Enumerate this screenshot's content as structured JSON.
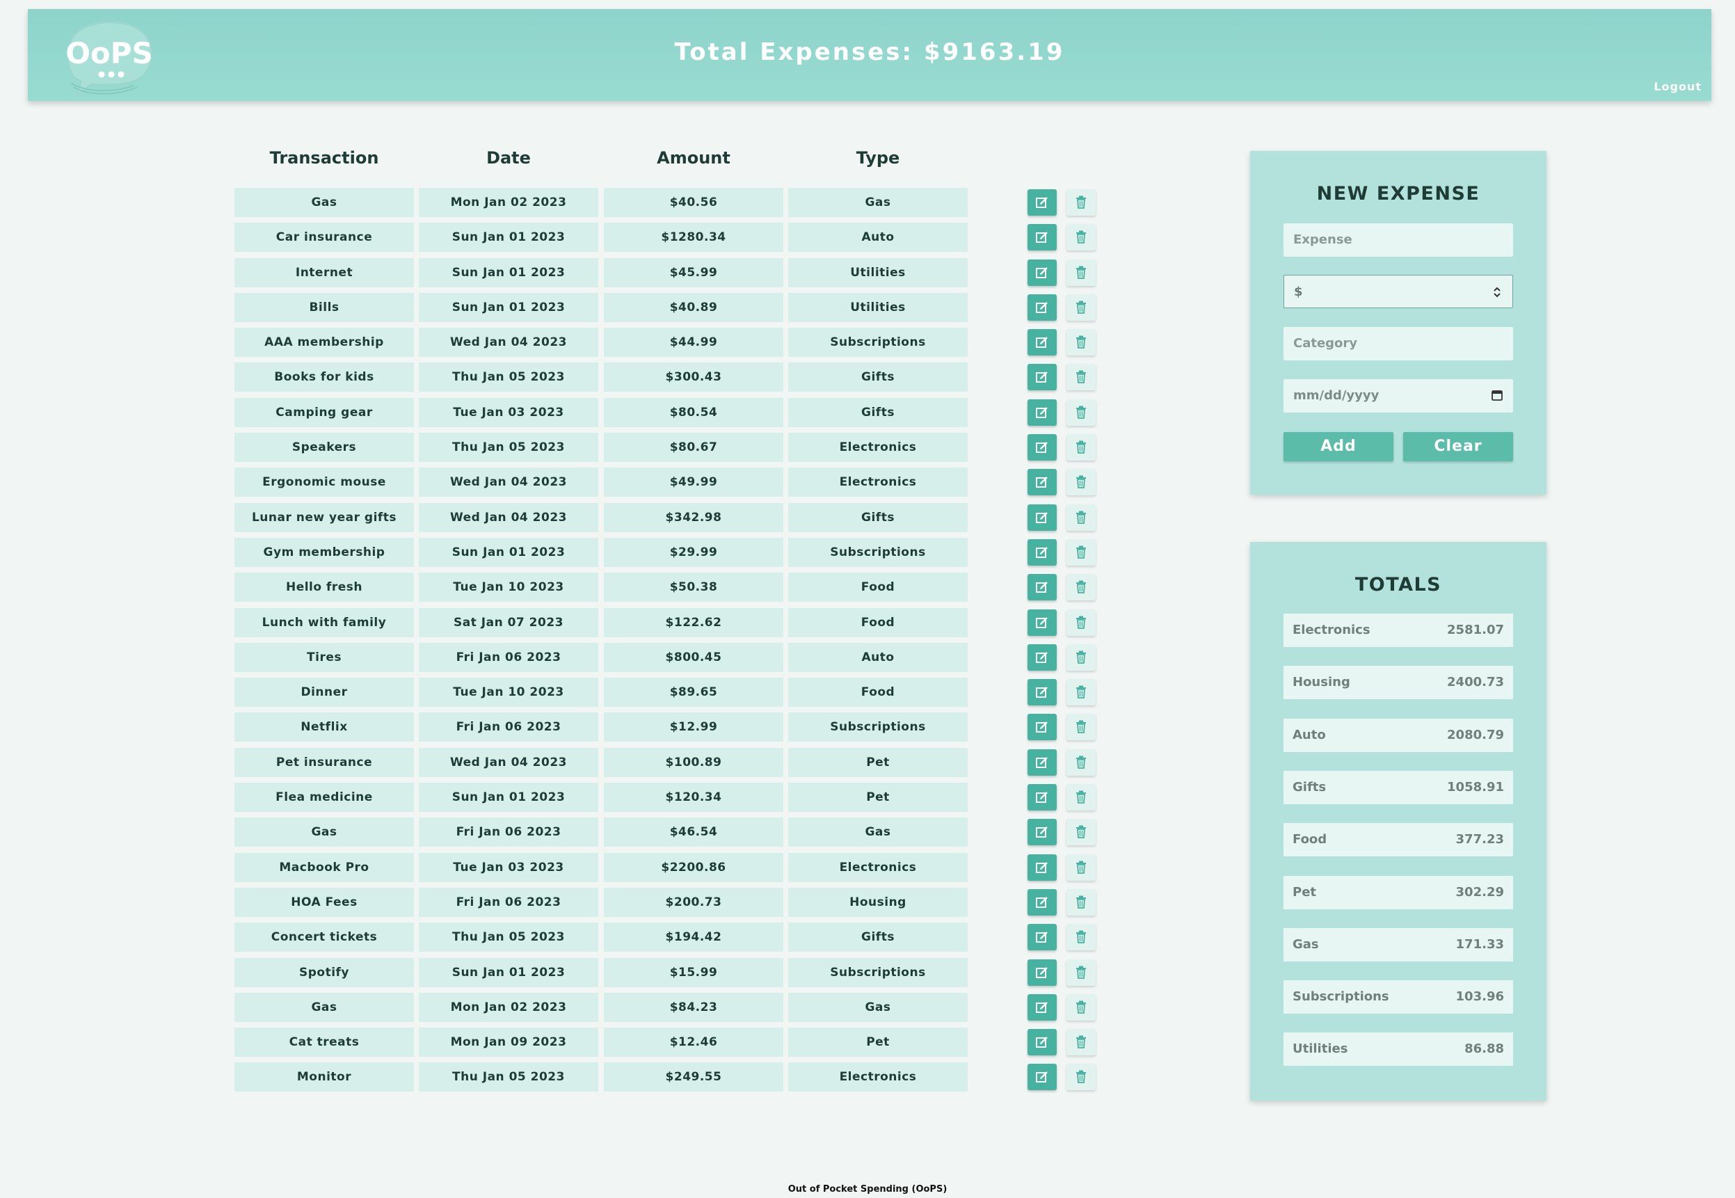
{
  "header": {
    "logo_text": "OoPS",
    "title": "Total Expenses: $9163.19",
    "logout_label": "Logout"
  },
  "colors": {
    "header_bg": "#8ed4cb",
    "cell_bg": "#d6efeb",
    "accent": "#47b29f",
    "panel_bg": "#b3e2dc",
    "page_bg": "#f1f6f5"
  },
  "table": {
    "columns": [
      "Transaction",
      "Date",
      "Amount",
      "Type"
    ],
    "rows": [
      {
        "transaction": "Gas",
        "date": "Mon Jan 02 2023",
        "amount": "$40.56",
        "type": "Gas"
      },
      {
        "transaction": "Car insurance",
        "date": "Sun Jan 01 2023",
        "amount": "$1280.34",
        "type": "Auto"
      },
      {
        "transaction": "Internet",
        "date": "Sun Jan 01 2023",
        "amount": "$45.99",
        "type": "Utilities"
      },
      {
        "transaction": "Bills",
        "date": "Sun Jan 01 2023",
        "amount": "$40.89",
        "type": "Utilities"
      },
      {
        "transaction": "AAA membership",
        "date": "Wed Jan 04 2023",
        "amount": "$44.99",
        "type": "Subscriptions"
      },
      {
        "transaction": "Books for kids",
        "date": "Thu Jan 05 2023",
        "amount": "$300.43",
        "type": "Gifts"
      },
      {
        "transaction": "Camping gear",
        "date": "Tue Jan 03 2023",
        "amount": "$80.54",
        "type": "Gifts"
      },
      {
        "transaction": "Speakers",
        "date": "Thu Jan 05 2023",
        "amount": "$80.67",
        "type": "Electronics"
      },
      {
        "transaction": "Ergonomic mouse",
        "date": "Wed Jan 04 2023",
        "amount": "$49.99",
        "type": "Electronics"
      },
      {
        "transaction": "Lunar new year gifts",
        "date": "Wed Jan 04 2023",
        "amount": "$342.98",
        "type": "Gifts"
      },
      {
        "transaction": "Gym membership",
        "date": "Sun Jan 01 2023",
        "amount": "$29.99",
        "type": "Subscriptions"
      },
      {
        "transaction": "Hello fresh",
        "date": "Tue Jan 10 2023",
        "amount": "$50.38",
        "type": "Food"
      },
      {
        "transaction": "Lunch with family",
        "date": "Sat Jan 07 2023",
        "amount": "$122.62",
        "type": "Food"
      },
      {
        "transaction": "Tires",
        "date": "Fri Jan 06 2023",
        "amount": "$800.45",
        "type": "Auto"
      },
      {
        "transaction": "Dinner",
        "date": "Tue Jan 10 2023",
        "amount": "$89.65",
        "type": "Food"
      },
      {
        "transaction": "Netflix",
        "date": "Fri Jan 06 2023",
        "amount": "$12.99",
        "type": "Subscriptions"
      },
      {
        "transaction": "Pet insurance",
        "date": "Wed Jan 04 2023",
        "amount": "$100.89",
        "type": "Pet"
      },
      {
        "transaction": "Flea medicine",
        "date": "Sun Jan 01 2023",
        "amount": "$120.34",
        "type": "Pet"
      },
      {
        "transaction": "Gas",
        "date": "Fri Jan 06 2023",
        "amount": "$46.54",
        "type": "Gas"
      },
      {
        "transaction": "Macbook Pro",
        "date": "Tue Jan 03 2023",
        "amount": "$2200.86",
        "type": "Electronics"
      },
      {
        "transaction": "HOA Fees",
        "date": "Fri Jan 06 2023",
        "amount": "$200.73",
        "type": "Housing"
      },
      {
        "transaction": "Concert tickets",
        "date": "Thu Jan 05 2023",
        "amount": "$194.42",
        "type": "Gifts"
      },
      {
        "transaction": "Spotify",
        "date": "Sun Jan 01 2023",
        "amount": "$15.99",
        "type": "Subscriptions"
      },
      {
        "transaction": "Gas",
        "date": "Mon Jan 02 2023",
        "amount": "$84.23",
        "type": "Gas"
      },
      {
        "transaction": "Cat treats",
        "date": "Mon Jan 09 2023",
        "amount": "$12.46",
        "type": "Pet"
      },
      {
        "transaction": "Monitor",
        "date": "Thu Jan 05 2023",
        "amount": "$249.55",
        "type": "Electronics"
      }
    ],
    "row_icons": {
      "edit": "edit-icon",
      "delete": "trash-icon"
    }
  },
  "new_expense": {
    "title": "NEW EXPENSE",
    "expense_placeholder": "Expense",
    "amount_placeholder": "$",
    "category_placeholder": "Category",
    "date_placeholder": "mm/dd/yyyy",
    "add_label": "Add",
    "clear_label": "Clear"
  },
  "totals": {
    "title": "TOTALS",
    "items": [
      {
        "category": "Electronics",
        "value": "2581.07"
      },
      {
        "category": "Housing",
        "value": "2400.73"
      },
      {
        "category": "Auto",
        "value": "2080.79"
      },
      {
        "category": "Gifts",
        "value": "1058.91"
      },
      {
        "category": "Food",
        "value": "377.23"
      },
      {
        "category": "Pet",
        "value": "302.29"
      },
      {
        "category": "Gas",
        "value": "171.33"
      },
      {
        "category": "Subscriptions",
        "value": "103.96"
      },
      {
        "category": "Utilities",
        "value": "86.88"
      }
    ]
  },
  "footer": {
    "text": "Out of Pocket Spending (OoPS)"
  }
}
